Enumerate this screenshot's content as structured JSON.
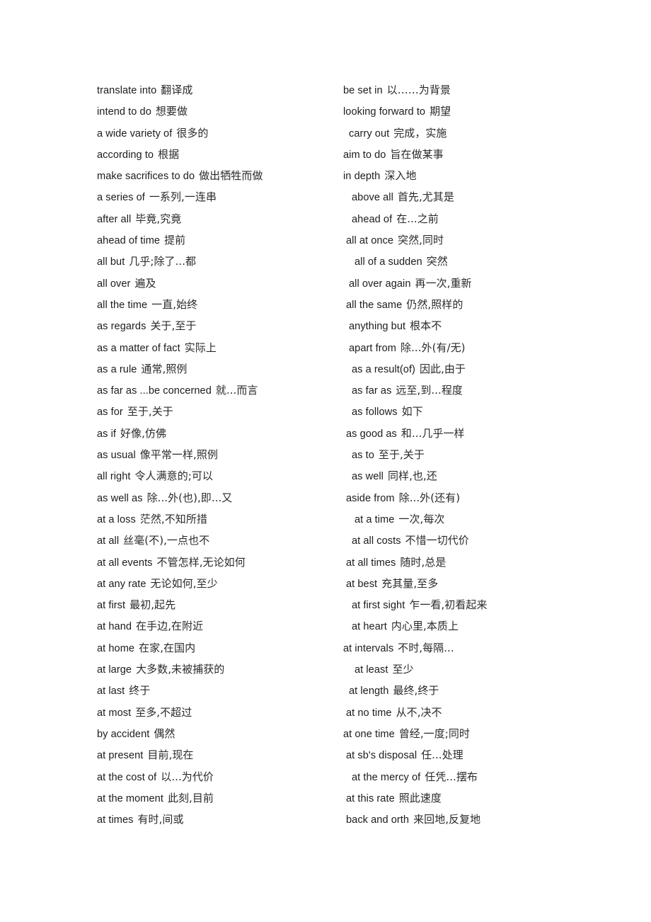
{
  "document": {
    "background_color": "#ffffff",
    "text_color": "#1a1a1a",
    "columns": [
      {
        "name": "left-column",
        "entries": [
          {
            "en": "translate into",
            "cn": "翻译成",
            "indent": 0
          },
          {
            "en": "intend to do",
            "cn": "想要做",
            "indent": 0
          },
          {
            "en": "a wide variety of",
            "cn": "很多的",
            "indent": 0
          },
          {
            "en": "according to",
            "cn": "根据",
            "indent": 0
          },
          {
            "en": "make sacrifices to do",
            "cn": "做出牺牲而做",
            "indent": 0
          },
          {
            "en": "a series of",
            "cn": "一系列,一连串",
            "indent": 0
          },
          {
            "en": "after all",
            "cn": "毕竟,究竟",
            "indent": 0
          },
          {
            "en": "ahead of time",
            "cn": "提前",
            "indent": 0
          },
          {
            "en": "all but",
            "cn": "几乎;除了...都",
            "indent": 0
          },
          {
            "en": "all over",
            "cn": "遍及",
            "indent": 0
          },
          {
            "en": "all the time",
            "cn": "一直,始终",
            "indent": 0
          },
          {
            "en": "as regards",
            "cn": "关于,至于",
            "indent": 0
          },
          {
            "en": "as a matter of fact",
            "cn": "实际上",
            "indent": 0
          },
          {
            "en": "as a rule",
            "cn": "通常,照例",
            "indent": 0
          },
          {
            "en": "as far as ...be concerned",
            "cn": "就...而言",
            "indent": 0
          },
          {
            "en": "as for",
            "cn": "至于,关于",
            "indent": 0
          },
          {
            "en": "as if",
            "cn": "好像,仿佛",
            "indent": 0
          },
          {
            "en": "as usual",
            "cn": "像平常一样,照例",
            "indent": 0
          },
          {
            "en": "all right",
            "cn": "令人满意的;可以",
            "indent": 0
          },
          {
            "en": "as well as",
            "cn": "除...外(也),即...又",
            "indent": 0
          },
          {
            "en": "at a loss",
            "cn": "茫然,不知所措",
            "indent": 0
          },
          {
            "en": "at all",
            "cn": "丝毫(不),一点也不",
            "indent": 0
          },
          {
            "en": "at all events",
            "cn": "不管怎样,无论如何",
            "indent": 0
          },
          {
            "en": "at any rate",
            "cn": "无论如何,至少",
            "indent": 0
          },
          {
            "en": "at first",
            "cn": "最初,起先",
            "indent": 0
          },
          {
            "en": "at hand",
            "cn": "在手边,在附近",
            "indent": 0
          },
          {
            "en": "at home",
            "cn": "在家,在国内",
            "indent": 0
          },
          {
            "en": "at large",
            "cn": "大多数,未被捕获的",
            "indent": 0
          },
          {
            "en": "at last",
            "cn": "终于",
            "indent": 0
          },
          {
            "en": "at most",
            "cn": "至多,不超过",
            "indent": 0
          },
          {
            "en": "by accident",
            "cn": "偶然",
            "indent": 0
          },
          {
            "en": "at present",
            "cn": "目前,现在",
            "indent": 0
          },
          {
            "en": "at the cost of",
            "cn": "以...为代价",
            "indent": 0
          },
          {
            "en": "at the moment",
            "cn": "此刻,目前",
            "indent": 0
          },
          {
            "en": "at times",
            "cn": "有时,间或",
            "indent": 0
          }
        ]
      },
      {
        "name": "right-column",
        "entries": [
          {
            "en": "be set in",
            "cn": "以……为背景",
            "indent": 0
          },
          {
            "en": "looking forward to",
            "cn": "期望",
            "indent": 0
          },
          {
            "en": "carry out",
            "cn": "完成，实施",
            "indent": 2
          },
          {
            "en": "aim to do",
            "cn": "旨在做某事",
            "indent": 0
          },
          {
            "en": "in depth",
            "cn": "深入地",
            "indent": 0
          },
          {
            "en": "above all",
            "cn": "首先,尤其是",
            "indent": 3
          },
          {
            "en": "ahead of",
            "cn": "在...之前",
            "indent": 3
          },
          {
            "en": "all at once",
            "cn": "突然,同时",
            "indent": 1
          },
          {
            "en": "all of a sudden",
            "cn": "突然",
            "indent": 4
          },
          {
            "en": "all over again",
            "cn": "再一次,重新",
            "indent": 2
          },
          {
            "en": "all the same",
            "cn": "仍然,照样的",
            "indent": 1
          },
          {
            "en": "anything but",
            "cn": "根本不",
            "indent": 2
          },
          {
            "en": "apart from",
            "cn": "除...外(有/无)",
            "indent": 2
          },
          {
            "en": "as a result(of)",
            "cn": "因此,由于",
            "indent": 3
          },
          {
            "en": "as far as",
            "cn": "远至,到...程度",
            "indent": 3
          },
          {
            "en": "as follows",
            "cn": "如下",
            "indent": 3
          },
          {
            "en": "as good as",
            "cn": "和...几乎一样",
            "indent": 1
          },
          {
            "en": "as to",
            "cn": "至于,关于",
            "indent": 3
          },
          {
            "en": "as well",
            "cn": "同样,也,还",
            "indent": 3
          },
          {
            "en": "aside from",
            "cn": "除...外(还有)",
            "indent": 1
          },
          {
            "en": "at a time",
            "cn": "一次,每次",
            "indent": 4
          },
          {
            "en": "at all costs",
            "cn": "不惜一切代价",
            "indent": 3
          },
          {
            "en": "at all times",
            "cn": "随时,总是",
            "indent": 1
          },
          {
            "en": "at best",
            "cn": "充其量,至多",
            "indent": 1
          },
          {
            "en": "at first sight",
            "cn": "乍一看,初看起来",
            "indent": 3
          },
          {
            "en": "at heart",
            "cn": "内心里,本质上",
            "indent": 3
          },
          {
            "en": "at intervals",
            "cn": "不时,每隔...",
            "indent": 0
          },
          {
            "en": "at least",
            "cn": "至少",
            "indent": 4
          },
          {
            "en": "at length",
            "cn": "最终,终于",
            "indent": 2
          },
          {
            "en": "at no time",
            "cn": "从不,决不",
            "indent": 1
          },
          {
            "en": "at one time",
            "cn": "曾经,一度;同时",
            "indent": 0
          },
          {
            "en": "at sb's disposal",
            "cn": "任...处理",
            "indent": 1
          },
          {
            "en": "at the mercy of",
            "cn": "任凭...摆布",
            "indent": 3
          },
          {
            "en": "at this rate",
            "cn": "照此速度",
            "indent": 1
          },
          {
            "en": "back and orth",
            "cn": "来回地,反复地",
            "indent": 1
          }
        ]
      }
    ]
  }
}
